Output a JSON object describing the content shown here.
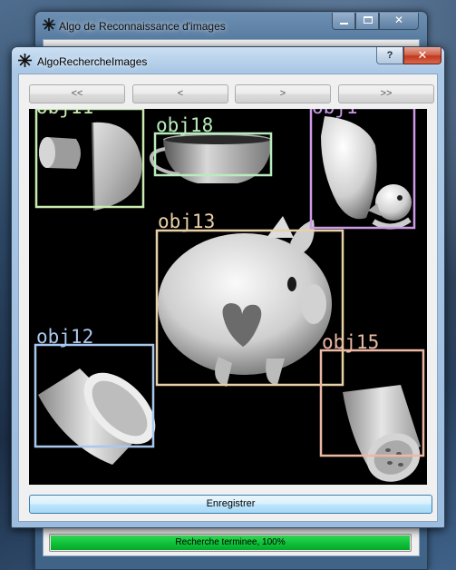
{
  "background_window": {
    "title": "Algo de Reconnaissance d'images",
    "progress": {
      "label": "Recherche terminee, 100%",
      "value": 100
    }
  },
  "dialog": {
    "title": "AlgoRechercheImages",
    "help_label": "?",
    "close_label": "✕",
    "nav": {
      "first": "<<",
      "prev": "<",
      "next": ">",
      "last": ">>"
    },
    "save_label": "Enregistrer"
  },
  "detections": [
    {
      "label": "obj11",
      "color": "#c8ecb0"
    },
    {
      "label": "obj18",
      "color": "#b8ecbc"
    },
    {
      "label": "obj1",
      "color": "#cc9ae6"
    },
    {
      "label": "obj13",
      "color": "#e8d0a8"
    },
    {
      "label": "obj12",
      "color": "#a9c8ee"
    },
    {
      "label": "obj15",
      "color": "#ecb8a4"
    }
  ]
}
